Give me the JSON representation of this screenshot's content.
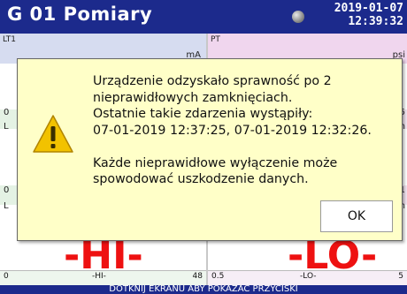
{
  "header": {
    "title": "G 01  Pomiary",
    "date": "2019-01-07",
    "time": "12:39:32"
  },
  "channels": {
    "left": {
      "name": "LT1",
      "unit": "mA",
      "value": "-HI-",
      "bar_min": "0",
      "bar_label": "-HI-",
      "bar_max": "48",
      "mid_left_1": "0",
      "mid_left_2": "L",
      "mid_left_3": "0",
      "mid_left_4": "L"
    },
    "right": {
      "name": "PT",
      "unit": "psi",
      "value": "-LO-",
      "bar_min": "0.5",
      "bar_label": "-LO-",
      "bar_max": "5",
      "mid_right_1": "5",
      "mid_right_2": "m",
      "mid_right_3": "1",
      "mid_right_4": "m"
    }
  },
  "dialog": {
    "message": "Urządzenie odzyskało sprawność po 2\nnieprawidłowych zamknięciach.\nOstatnie takie zdarzenia wystąpiły:\n07-01-2019 12:37:25, 07-01-2019 12:32:26.\n\nKażde nieprawidłowe wyłączenie może\nspowodować uszkodzenie danych.",
    "ok_label": "OK"
  },
  "footer": {
    "hint": "DOTKNIJ EKRANU ABY POKAZAĆ PRZYCISKI"
  },
  "colors": {
    "header_bg": "#1c2a8c",
    "dialog_bg": "#ffffc8",
    "value_red": "#ee1111",
    "left_panel": "#d6dcf0",
    "right_panel": "#f0d6ee",
    "mid_panel": "#d8f0d8"
  }
}
